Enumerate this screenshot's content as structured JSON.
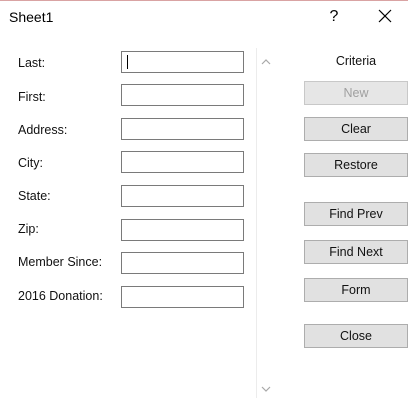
{
  "window": {
    "title": "Sheet1",
    "help_label": "?",
    "close_icon": "close-icon"
  },
  "fields": [
    {
      "label": "Last:",
      "value": ""
    },
    {
      "label": "First:",
      "value": ""
    },
    {
      "label": "Address:",
      "value": ""
    },
    {
      "label": "City:",
      "value": ""
    },
    {
      "label": "State:",
      "value": ""
    },
    {
      "label": "Zip:",
      "value": ""
    },
    {
      "label": "Member Since:",
      "value": ""
    },
    {
      "label": "2016 Donation:",
      "value": ""
    }
  ],
  "record_status": "Criteria",
  "buttons": {
    "new": "New",
    "clear": "Clear",
    "restore": "Restore",
    "find_prev": "Find Prev",
    "find_next": "Find Next",
    "form": "Form",
    "close": "Close"
  },
  "scrollbar": {
    "up_icon": "chevron-up-icon",
    "down_icon": "chevron-down-icon"
  }
}
